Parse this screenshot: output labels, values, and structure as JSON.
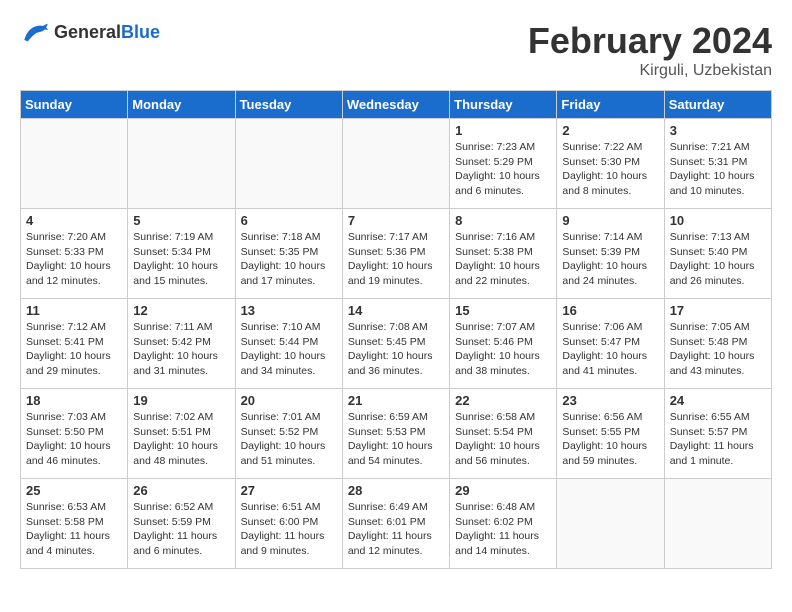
{
  "header": {
    "logo_general": "General",
    "logo_blue": "Blue",
    "month_year": "February 2024",
    "location": "Kirguli, Uzbekistan"
  },
  "days_of_week": [
    "Sunday",
    "Monday",
    "Tuesday",
    "Wednesday",
    "Thursday",
    "Friday",
    "Saturday"
  ],
  "weeks": [
    [
      {
        "day": "",
        "sunrise": "",
        "sunset": "",
        "daylight": ""
      },
      {
        "day": "",
        "sunrise": "",
        "sunset": "",
        "daylight": ""
      },
      {
        "day": "",
        "sunrise": "",
        "sunset": "",
        "daylight": ""
      },
      {
        "day": "",
        "sunrise": "",
        "sunset": "",
        "daylight": ""
      },
      {
        "day": "1",
        "sunrise": "Sunrise: 7:23 AM",
        "sunset": "Sunset: 5:29 PM",
        "daylight": "Daylight: 10 hours and 6 minutes."
      },
      {
        "day": "2",
        "sunrise": "Sunrise: 7:22 AM",
        "sunset": "Sunset: 5:30 PM",
        "daylight": "Daylight: 10 hours and 8 minutes."
      },
      {
        "day": "3",
        "sunrise": "Sunrise: 7:21 AM",
        "sunset": "Sunset: 5:31 PM",
        "daylight": "Daylight: 10 hours and 10 minutes."
      }
    ],
    [
      {
        "day": "4",
        "sunrise": "Sunrise: 7:20 AM",
        "sunset": "Sunset: 5:33 PM",
        "daylight": "Daylight: 10 hours and 12 minutes."
      },
      {
        "day": "5",
        "sunrise": "Sunrise: 7:19 AM",
        "sunset": "Sunset: 5:34 PM",
        "daylight": "Daylight: 10 hours and 15 minutes."
      },
      {
        "day": "6",
        "sunrise": "Sunrise: 7:18 AM",
        "sunset": "Sunset: 5:35 PM",
        "daylight": "Daylight: 10 hours and 17 minutes."
      },
      {
        "day": "7",
        "sunrise": "Sunrise: 7:17 AM",
        "sunset": "Sunset: 5:36 PM",
        "daylight": "Daylight: 10 hours and 19 minutes."
      },
      {
        "day": "8",
        "sunrise": "Sunrise: 7:16 AM",
        "sunset": "Sunset: 5:38 PM",
        "daylight": "Daylight: 10 hours and 22 minutes."
      },
      {
        "day": "9",
        "sunrise": "Sunrise: 7:14 AM",
        "sunset": "Sunset: 5:39 PM",
        "daylight": "Daylight: 10 hours and 24 minutes."
      },
      {
        "day": "10",
        "sunrise": "Sunrise: 7:13 AM",
        "sunset": "Sunset: 5:40 PM",
        "daylight": "Daylight: 10 hours and 26 minutes."
      }
    ],
    [
      {
        "day": "11",
        "sunrise": "Sunrise: 7:12 AM",
        "sunset": "Sunset: 5:41 PM",
        "daylight": "Daylight: 10 hours and 29 minutes."
      },
      {
        "day": "12",
        "sunrise": "Sunrise: 7:11 AM",
        "sunset": "Sunset: 5:42 PM",
        "daylight": "Daylight: 10 hours and 31 minutes."
      },
      {
        "day": "13",
        "sunrise": "Sunrise: 7:10 AM",
        "sunset": "Sunset: 5:44 PM",
        "daylight": "Daylight: 10 hours and 34 minutes."
      },
      {
        "day": "14",
        "sunrise": "Sunrise: 7:08 AM",
        "sunset": "Sunset: 5:45 PM",
        "daylight": "Daylight: 10 hours and 36 minutes."
      },
      {
        "day": "15",
        "sunrise": "Sunrise: 7:07 AM",
        "sunset": "Sunset: 5:46 PM",
        "daylight": "Daylight: 10 hours and 38 minutes."
      },
      {
        "day": "16",
        "sunrise": "Sunrise: 7:06 AM",
        "sunset": "Sunset: 5:47 PM",
        "daylight": "Daylight: 10 hours and 41 minutes."
      },
      {
        "day": "17",
        "sunrise": "Sunrise: 7:05 AM",
        "sunset": "Sunset: 5:48 PM",
        "daylight": "Daylight: 10 hours and 43 minutes."
      }
    ],
    [
      {
        "day": "18",
        "sunrise": "Sunrise: 7:03 AM",
        "sunset": "Sunset: 5:50 PM",
        "daylight": "Daylight: 10 hours and 46 minutes."
      },
      {
        "day": "19",
        "sunrise": "Sunrise: 7:02 AM",
        "sunset": "Sunset: 5:51 PM",
        "daylight": "Daylight: 10 hours and 48 minutes."
      },
      {
        "day": "20",
        "sunrise": "Sunrise: 7:01 AM",
        "sunset": "Sunset: 5:52 PM",
        "daylight": "Daylight: 10 hours and 51 minutes."
      },
      {
        "day": "21",
        "sunrise": "Sunrise: 6:59 AM",
        "sunset": "Sunset: 5:53 PM",
        "daylight": "Daylight: 10 hours and 54 minutes."
      },
      {
        "day": "22",
        "sunrise": "Sunrise: 6:58 AM",
        "sunset": "Sunset: 5:54 PM",
        "daylight": "Daylight: 10 hours and 56 minutes."
      },
      {
        "day": "23",
        "sunrise": "Sunrise: 6:56 AM",
        "sunset": "Sunset: 5:55 PM",
        "daylight": "Daylight: 10 hours and 59 minutes."
      },
      {
        "day": "24",
        "sunrise": "Sunrise: 6:55 AM",
        "sunset": "Sunset: 5:57 PM",
        "daylight": "Daylight: 11 hours and 1 minute."
      }
    ],
    [
      {
        "day": "25",
        "sunrise": "Sunrise: 6:53 AM",
        "sunset": "Sunset: 5:58 PM",
        "daylight": "Daylight: 11 hours and 4 minutes."
      },
      {
        "day": "26",
        "sunrise": "Sunrise: 6:52 AM",
        "sunset": "Sunset: 5:59 PM",
        "daylight": "Daylight: 11 hours and 6 minutes."
      },
      {
        "day": "27",
        "sunrise": "Sunrise: 6:51 AM",
        "sunset": "Sunset: 6:00 PM",
        "daylight": "Daylight: 11 hours and 9 minutes."
      },
      {
        "day": "28",
        "sunrise": "Sunrise: 6:49 AM",
        "sunset": "Sunset: 6:01 PM",
        "daylight": "Daylight: 11 hours and 12 minutes."
      },
      {
        "day": "29",
        "sunrise": "Sunrise: 6:48 AM",
        "sunset": "Sunset: 6:02 PM",
        "daylight": "Daylight: 11 hours and 14 minutes."
      },
      {
        "day": "",
        "sunrise": "",
        "sunset": "",
        "daylight": ""
      },
      {
        "day": "",
        "sunrise": "",
        "sunset": "",
        "daylight": ""
      }
    ]
  ]
}
